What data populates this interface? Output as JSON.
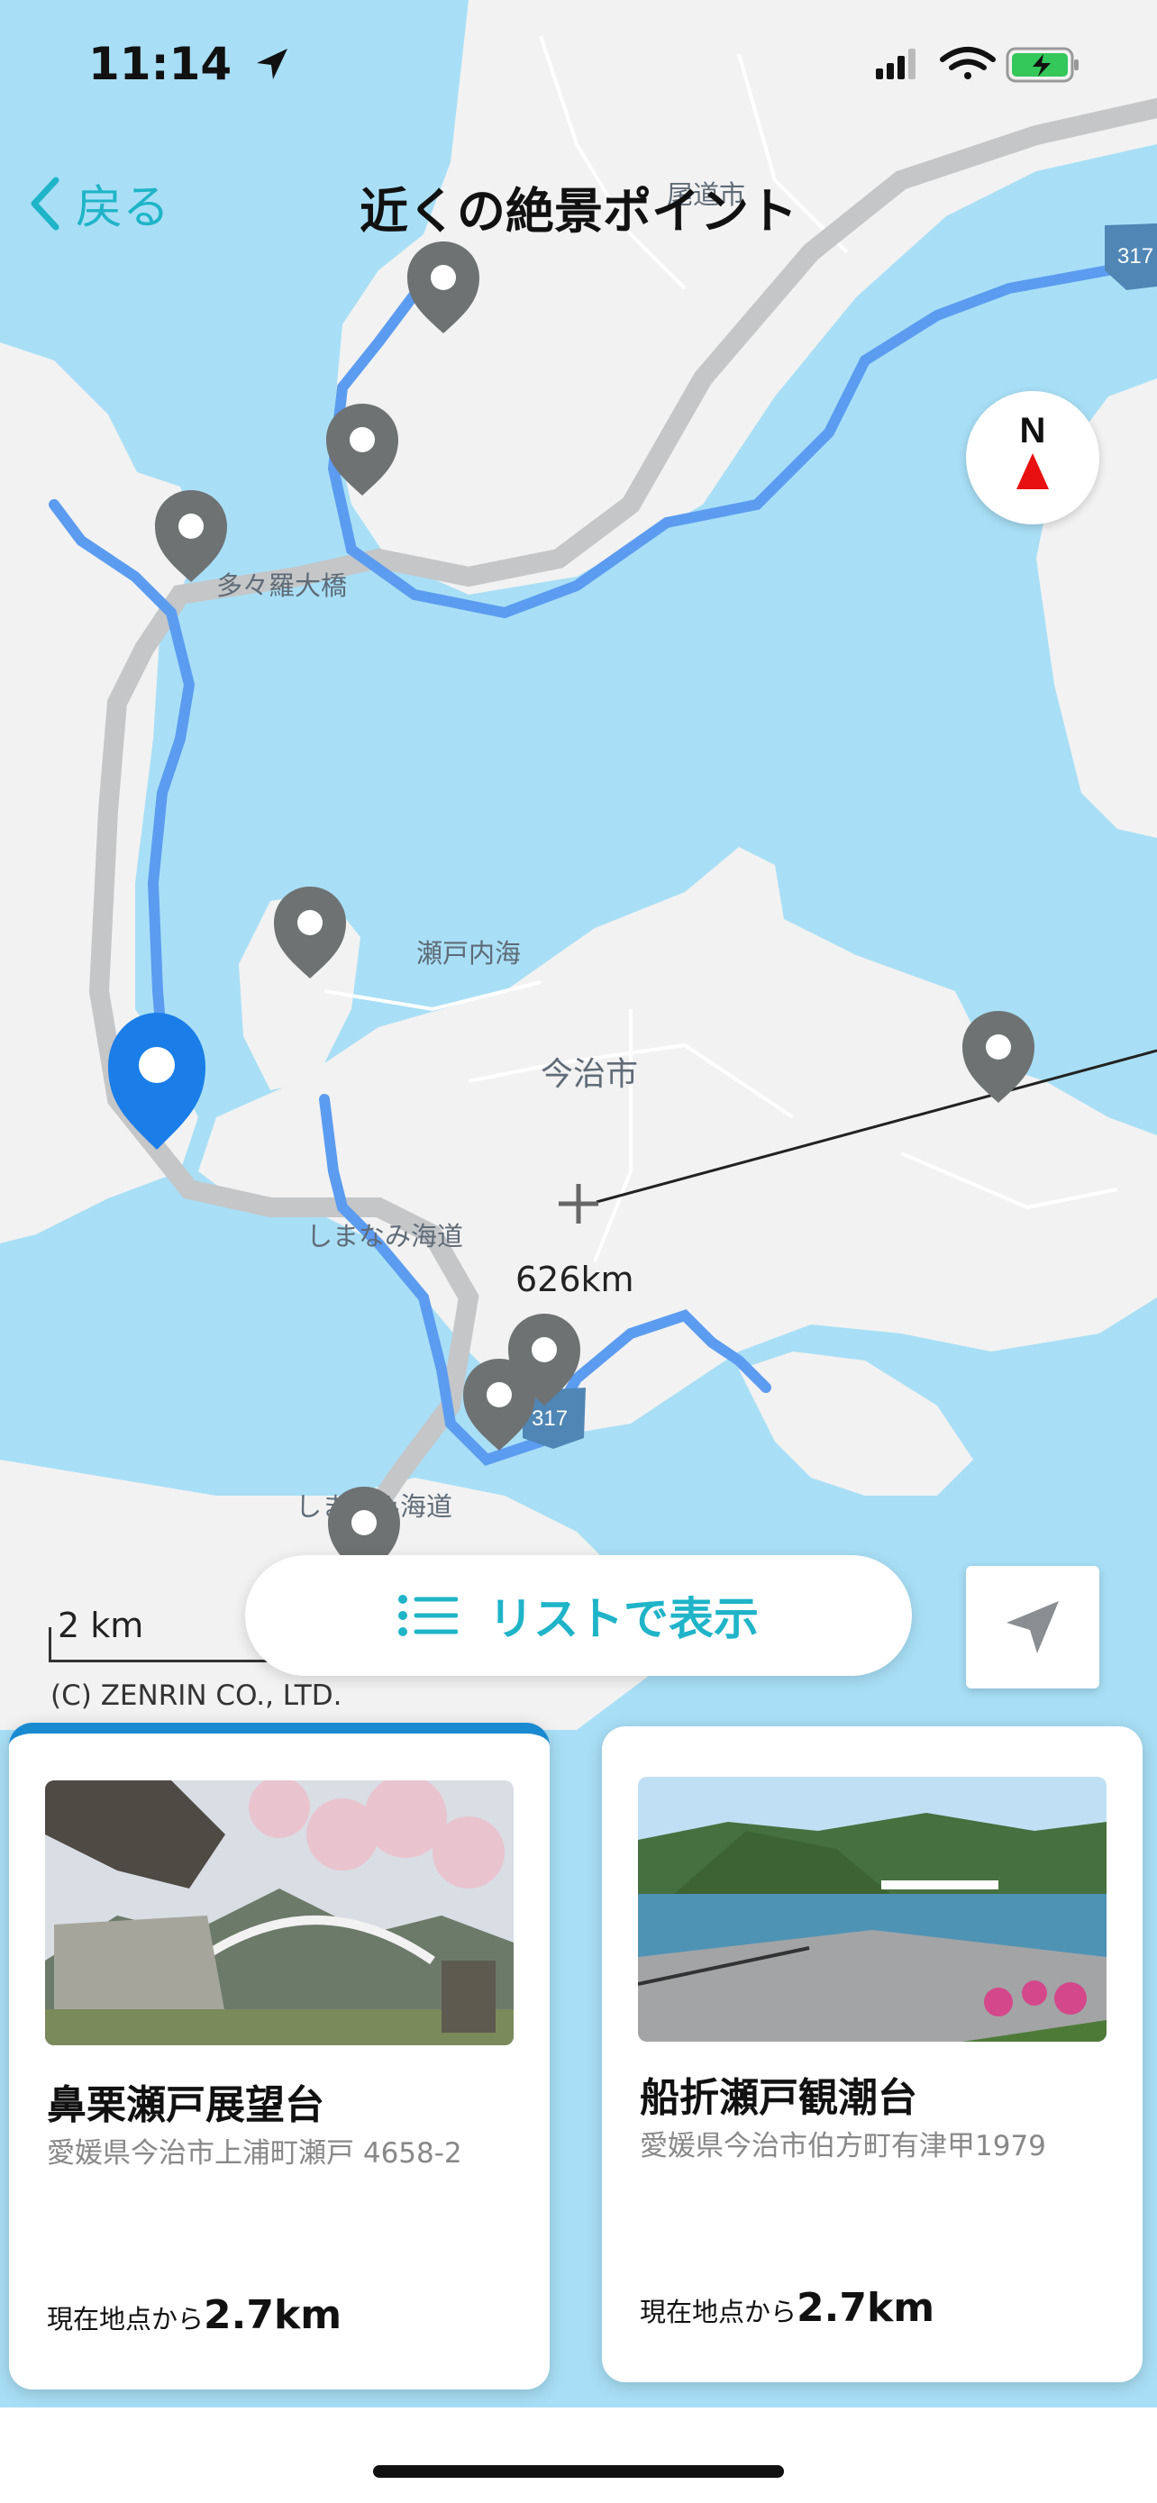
{
  "status_bar": {
    "time": "11:14",
    "icons": [
      "location-arrow-icon",
      "signal-icon",
      "wifi-icon",
      "battery-charging-icon"
    ]
  },
  "nav": {
    "back_label": "戻る",
    "title": "近くの絶景ポイント"
  },
  "compass": {
    "label": "N"
  },
  "map": {
    "labels": {
      "tatara_bridge": "多々羅大橋",
      "seto_naikai": "瀬戸内海",
      "imabari": "今治市",
      "shimanami": "しまなみ海道",
      "shimanami2": "しまなみ海道",
      "city_top": "尾道市",
      "route_317": "317",
      "route_317b": "317"
    },
    "distance_label": "626km",
    "scale": "2 km",
    "copyright": "(C) ZENRIN CO., LTD."
  },
  "list_button": {
    "label": "リストで表示"
  },
  "cards": [
    {
      "name": "鼻栗瀬戸展望台",
      "address": "愛媛県今治市上浦町瀬戸 4658-2",
      "distance_prefix": "現在地点から",
      "distance": "2.7km"
    },
    {
      "name": "船折瀬戸観潮台",
      "address": "愛媛県今治市伯方町有津甲1979",
      "distance_prefix": "現在地点から",
      "distance": "2.7km"
    }
  ],
  "colors": {
    "accent": "#1fb4c8",
    "sea": "#a8dff6",
    "land": "#f2f2f2",
    "route": "#5b9cf0",
    "selected_pin": "#1a7de8",
    "pin": "#6f7273"
  }
}
